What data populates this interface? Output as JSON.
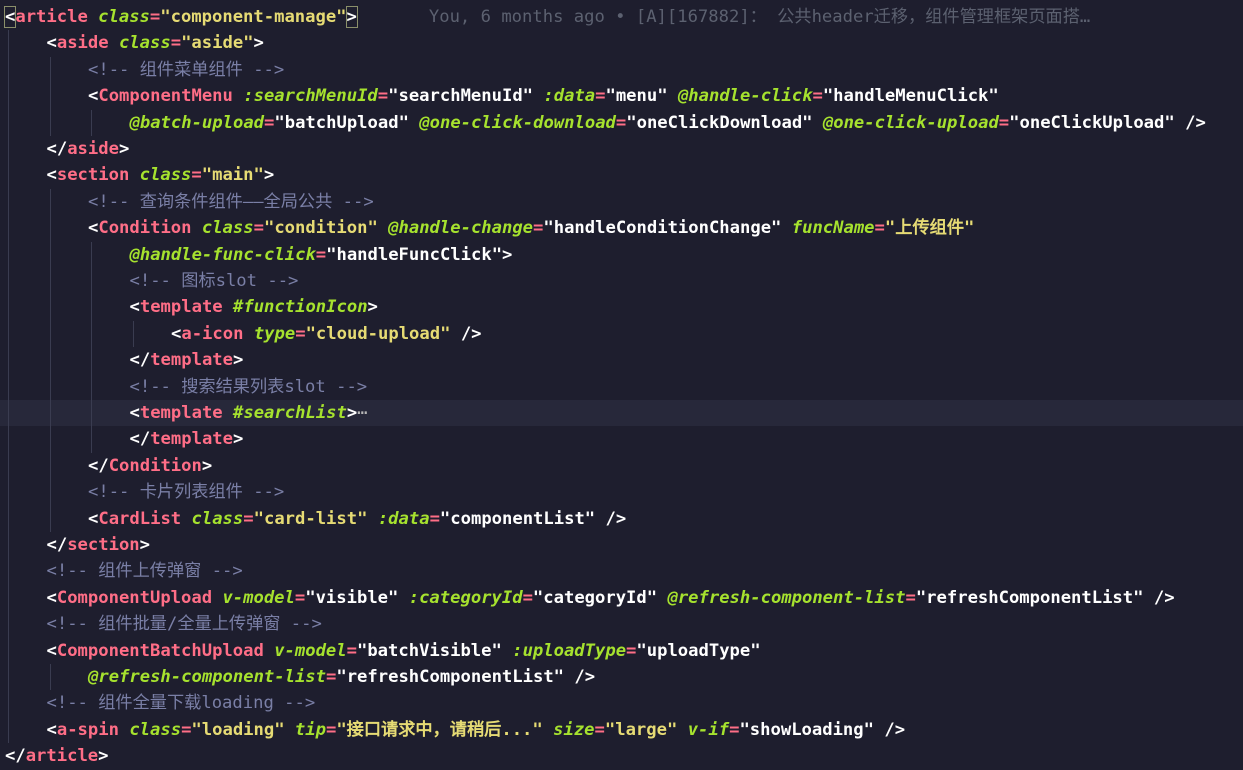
{
  "editor": {
    "blame": "You, 6 months ago • [A][167882]： 公共header迁移，组件管理框架页面搭…",
    "fold_marker": "⋯",
    "current_line": 15,
    "lines": [
      {
        "indent": 0,
        "tokens": [
          [
            "pb",
            "<"
          ],
          [
            "t",
            "article"
          ],
          [
            "s",
            " "
          ],
          [
            "a",
            "class"
          ],
          [
            "e",
            "="
          ],
          [
            "v",
            "\"component-manage\""
          ],
          [
            "pb",
            ">"
          ]
        ],
        "blame": true
      },
      {
        "indent": 1,
        "tokens": [
          [
            "p",
            "<"
          ],
          [
            "t",
            "aside"
          ],
          [
            "s",
            " "
          ],
          [
            "a",
            "class"
          ],
          [
            "e",
            "="
          ],
          [
            "v",
            "\"aside\""
          ],
          [
            "p",
            ">"
          ]
        ]
      },
      {
        "indent": 2,
        "tokens": [
          [
            "c",
            "<!-- 组件菜单组件 -->"
          ]
        ]
      },
      {
        "indent": 2,
        "tokens": [
          [
            "p",
            "<"
          ],
          [
            "t",
            "ComponentMenu"
          ],
          [
            "s",
            " "
          ],
          [
            "a",
            ":searchMenuId"
          ],
          [
            "e",
            "="
          ],
          [
            "w",
            "\"searchMenuId\""
          ],
          [
            "s",
            " "
          ],
          [
            "a",
            ":data"
          ],
          [
            "e",
            "="
          ],
          [
            "w",
            "\"menu\""
          ],
          [
            "s",
            " "
          ],
          [
            "a",
            "@handle-click"
          ],
          [
            "e",
            "="
          ],
          [
            "w",
            "\"handleMenuClick\""
          ]
        ]
      },
      {
        "indent": 3,
        "tokens": [
          [
            "a",
            "@batch-upload"
          ],
          [
            "e",
            "="
          ],
          [
            "w",
            "\"batchUpload\""
          ],
          [
            "s",
            " "
          ],
          [
            "a",
            "@one-click-download"
          ],
          [
            "e",
            "="
          ],
          [
            "w",
            "\"oneClickDownload\""
          ],
          [
            "s",
            " "
          ],
          [
            "a",
            "@one-click-upload"
          ],
          [
            "e",
            "="
          ],
          [
            "w",
            "\"oneClickUpload\""
          ],
          [
            "s",
            " "
          ],
          [
            "p",
            "/>"
          ]
        ]
      },
      {
        "indent": 1,
        "tokens": [
          [
            "p",
            "</"
          ],
          [
            "t",
            "aside"
          ],
          [
            "p",
            ">"
          ]
        ]
      },
      {
        "indent": 1,
        "tokens": [
          [
            "p",
            "<"
          ],
          [
            "t",
            "section"
          ],
          [
            "s",
            " "
          ],
          [
            "a",
            "class"
          ],
          [
            "e",
            "="
          ],
          [
            "v",
            "\"main\""
          ],
          [
            "p",
            ">"
          ]
        ]
      },
      {
        "indent": 2,
        "tokens": [
          [
            "c",
            "<!-- 查询条件组件——全局公共 -->"
          ]
        ]
      },
      {
        "indent": 2,
        "tokens": [
          [
            "p",
            "<"
          ],
          [
            "t",
            "Condition"
          ],
          [
            "s",
            " "
          ],
          [
            "a",
            "class"
          ],
          [
            "e",
            "="
          ],
          [
            "v",
            "\"condition\""
          ],
          [
            "s",
            " "
          ],
          [
            "a",
            "@handle-change"
          ],
          [
            "e",
            "="
          ],
          [
            "w",
            "\"handleConditionChange\""
          ],
          [
            "s",
            " "
          ],
          [
            "a",
            "funcName"
          ],
          [
            "e",
            "="
          ],
          [
            "v",
            "\"上传组件\""
          ]
        ]
      },
      {
        "indent": 3,
        "tokens": [
          [
            "a",
            "@handle-func-click"
          ],
          [
            "e",
            "="
          ],
          [
            "w",
            "\"handleFuncClick\""
          ],
          [
            "p",
            ">"
          ]
        ]
      },
      {
        "indent": 3,
        "tokens": [
          [
            "c",
            "<!-- 图标slot -->"
          ]
        ]
      },
      {
        "indent": 3,
        "tokens": [
          [
            "p",
            "<"
          ],
          [
            "t",
            "template"
          ],
          [
            "s",
            " "
          ],
          [
            "a",
            "#functionIcon"
          ],
          [
            "p",
            ">"
          ]
        ]
      },
      {
        "indent": 4,
        "tokens": [
          [
            "p",
            "<"
          ],
          [
            "t",
            "a-icon"
          ],
          [
            "s",
            " "
          ],
          [
            "a",
            "type"
          ],
          [
            "e",
            "="
          ],
          [
            "v",
            "\"cloud-upload\""
          ],
          [
            "s",
            " "
          ],
          [
            "p",
            "/>"
          ]
        ]
      },
      {
        "indent": 3,
        "tokens": [
          [
            "p",
            "</"
          ],
          [
            "t",
            "template"
          ],
          [
            "p",
            ">"
          ]
        ]
      },
      {
        "indent": 3,
        "tokens": [
          [
            "c",
            "<!-- 搜索结果列表slot -->"
          ]
        ]
      },
      {
        "indent": 3,
        "tokens": [
          [
            "p",
            "<"
          ],
          [
            "t",
            "template"
          ],
          [
            "s",
            " "
          ],
          [
            "a",
            "#searchList"
          ],
          [
            "p",
            ">"
          ],
          [
            "f",
            "⋯"
          ]
        ]
      },
      {
        "indent": 3,
        "tokens": [
          [
            "p",
            "</"
          ],
          [
            "t",
            "template"
          ],
          [
            "p",
            ">"
          ]
        ]
      },
      {
        "indent": 2,
        "tokens": [
          [
            "p",
            "</"
          ],
          [
            "t",
            "Condition"
          ],
          [
            "p",
            ">"
          ]
        ]
      },
      {
        "indent": 2,
        "tokens": [
          [
            "c",
            "<!-- 卡片列表组件 -->"
          ]
        ]
      },
      {
        "indent": 2,
        "tokens": [
          [
            "p",
            "<"
          ],
          [
            "t",
            "CardList"
          ],
          [
            "s",
            " "
          ],
          [
            "a",
            "class"
          ],
          [
            "e",
            "="
          ],
          [
            "v",
            "\"card-list\""
          ],
          [
            "s",
            " "
          ],
          [
            "a",
            ":data"
          ],
          [
            "e",
            "="
          ],
          [
            "w",
            "\"componentList\""
          ],
          [
            "s",
            " "
          ],
          [
            "p",
            "/>"
          ]
        ]
      },
      {
        "indent": 1,
        "tokens": [
          [
            "p",
            "</"
          ],
          [
            "t",
            "section"
          ],
          [
            "p",
            ">"
          ]
        ]
      },
      {
        "indent": 1,
        "tokens": [
          [
            "c",
            "<!-- 组件上传弹窗 -->"
          ]
        ]
      },
      {
        "indent": 1,
        "tokens": [
          [
            "p",
            "<"
          ],
          [
            "t",
            "ComponentUpload"
          ],
          [
            "s",
            " "
          ],
          [
            "a",
            "v-model"
          ],
          [
            "e",
            "="
          ],
          [
            "w",
            "\"visible\""
          ],
          [
            "s",
            " "
          ],
          [
            "a",
            ":categoryId"
          ],
          [
            "e",
            "="
          ],
          [
            "w",
            "\"categoryId\""
          ],
          [
            "s",
            " "
          ],
          [
            "a",
            "@refresh-component-list"
          ],
          [
            "e",
            "="
          ],
          [
            "w",
            "\"refreshComponentList\""
          ],
          [
            "s",
            " "
          ],
          [
            "p",
            "/>"
          ]
        ]
      },
      {
        "indent": 1,
        "tokens": [
          [
            "c",
            "<!-- 组件批量/全量上传弹窗 -->"
          ]
        ]
      },
      {
        "indent": 1,
        "tokens": [
          [
            "p",
            "<"
          ],
          [
            "t",
            "ComponentBatchUpload"
          ],
          [
            "s",
            " "
          ],
          [
            "a",
            "v-model"
          ],
          [
            "e",
            "="
          ],
          [
            "w",
            "\"batchVisible\""
          ],
          [
            "s",
            " "
          ],
          [
            "a",
            ":uploadType"
          ],
          [
            "e",
            "="
          ],
          [
            "w",
            "\"uploadType\""
          ]
        ]
      },
      {
        "indent": 2,
        "tokens": [
          [
            "a",
            "@refresh-component-list"
          ],
          [
            "e",
            "="
          ],
          [
            "w",
            "\"refreshComponentList\""
          ],
          [
            "s",
            " "
          ],
          [
            "p",
            "/>"
          ]
        ]
      },
      {
        "indent": 1,
        "tokens": [
          [
            "c",
            "<!-- 组件全量下载loading -->"
          ]
        ]
      },
      {
        "indent": 1,
        "tokens": [
          [
            "p",
            "<"
          ],
          [
            "t",
            "a-spin"
          ],
          [
            "s",
            " "
          ],
          [
            "a",
            "class"
          ],
          [
            "e",
            "="
          ],
          [
            "v",
            "\"loading\""
          ],
          [
            "s",
            " "
          ],
          [
            "a",
            "tip"
          ],
          [
            "e",
            "="
          ],
          [
            "v",
            "\"接口请求中，请稍后...\""
          ],
          [
            "s",
            " "
          ],
          [
            "a",
            "size"
          ],
          [
            "e",
            "="
          ],
          [
            "v",
            "\"large\""
          ],
          [
            "s",
            " "
          ],
          [
            "a",
            "v-if"
          ],
          [
            "e",
            "="
          ],
          [
            "w",
            "\"showLoading\""
          ],
          [
            "s",
            " "
          ],
          [
            "p",
            "/>"
          ]
        ]
      },
      {
        "indent": 0,
        "tokens": [
          [
            "p",
            "</"
          ],
          [
            "t",
            "article"
          ],
          [
            "p",
            ">"
          ]
        ]
      }
    ]
  }
}
